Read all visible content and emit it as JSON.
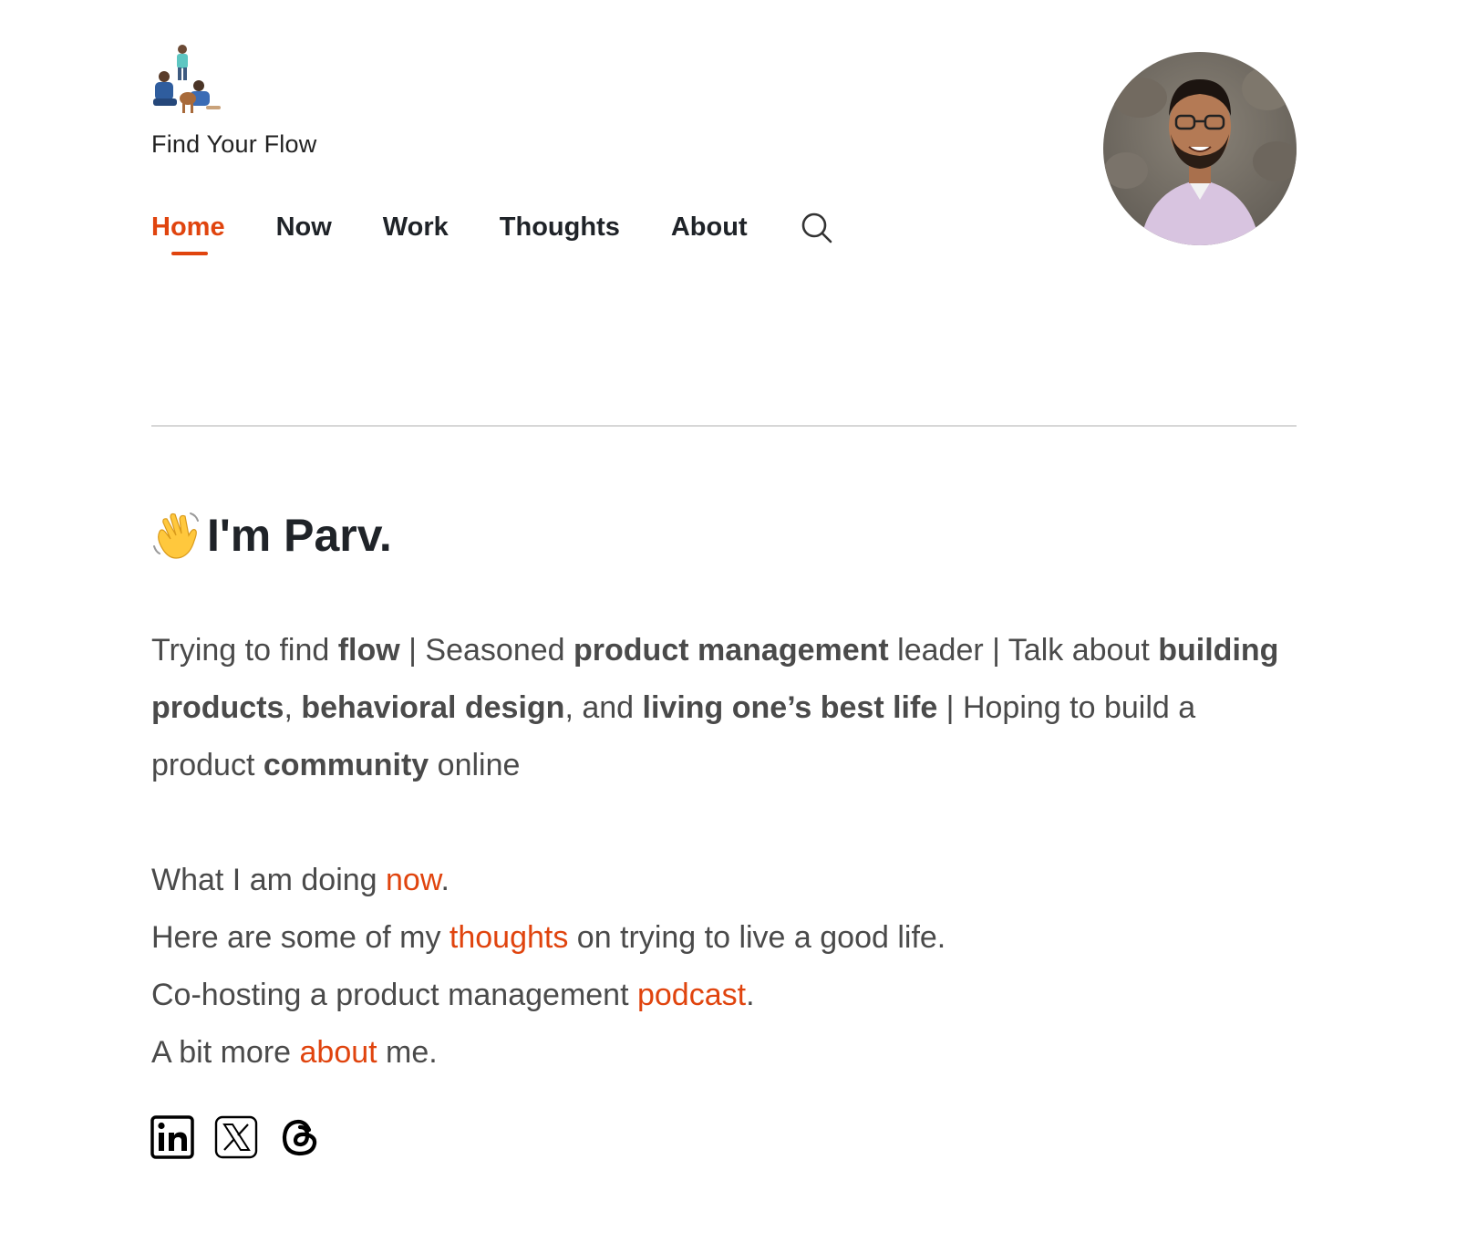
{
  "header": {
    "site_title": "Find Your Flow"
  },
  "nav": {
    "items": [
      {
        "label": "Home",
        "active": true
      },
      {
        "label": "Now",
        "active": false
      },
      {
        "label": "Work",
        "active": false
      },
      {
        "label": "Thoughts",
        "active": false
      },
      {
        "label": "About",
        "active": false
      }
    ],
    "search_icon": "search-icon"
  },
  "colors": {
    "accent": "#e0440e",
    "text": "#1f2328",
    "body_text": "#4a4a4a"
  },
  "hero": {
    "heading": "I'm Parv.",
    "emoji_icon": "waving-hand-icon"
  },
  "bio": {
    "p1": "Trying to find ",
    "b1": "flow",
    "sep1": " | Seasoned ",
    "b2": "product management",
    "p2": " leader | Talk about ",
    "b3": "building products",
    "p3": ", ",
    "b4": "behavioral design",
    "p4": ", and ",
    "b5": "living one’s best life",
    "p5": " | Hoping to build a product ",
    "b6": "community",
    "p6": " online"
  },
  "links": {
    "line1_pre": "What I am doing ",
    "line1_link": "now",
    "line1_post": ".",
    "line2_pre": "Here are some of my ",
    "line2_link": "thoughts",
    "line2_post": " on trying to live a good life.",
    "line3_pre": "Co-hosting a product management ",
    "line3_link": "podcast",
    "line3_post": ".",
    "line4_pre": "A bit more ",
    "line4_link": "about",
    "line4_post": " me."
  },
  "social": [
    "linkedin-icon",
    "x-icon",
    "threads-icon"
  ]
}
